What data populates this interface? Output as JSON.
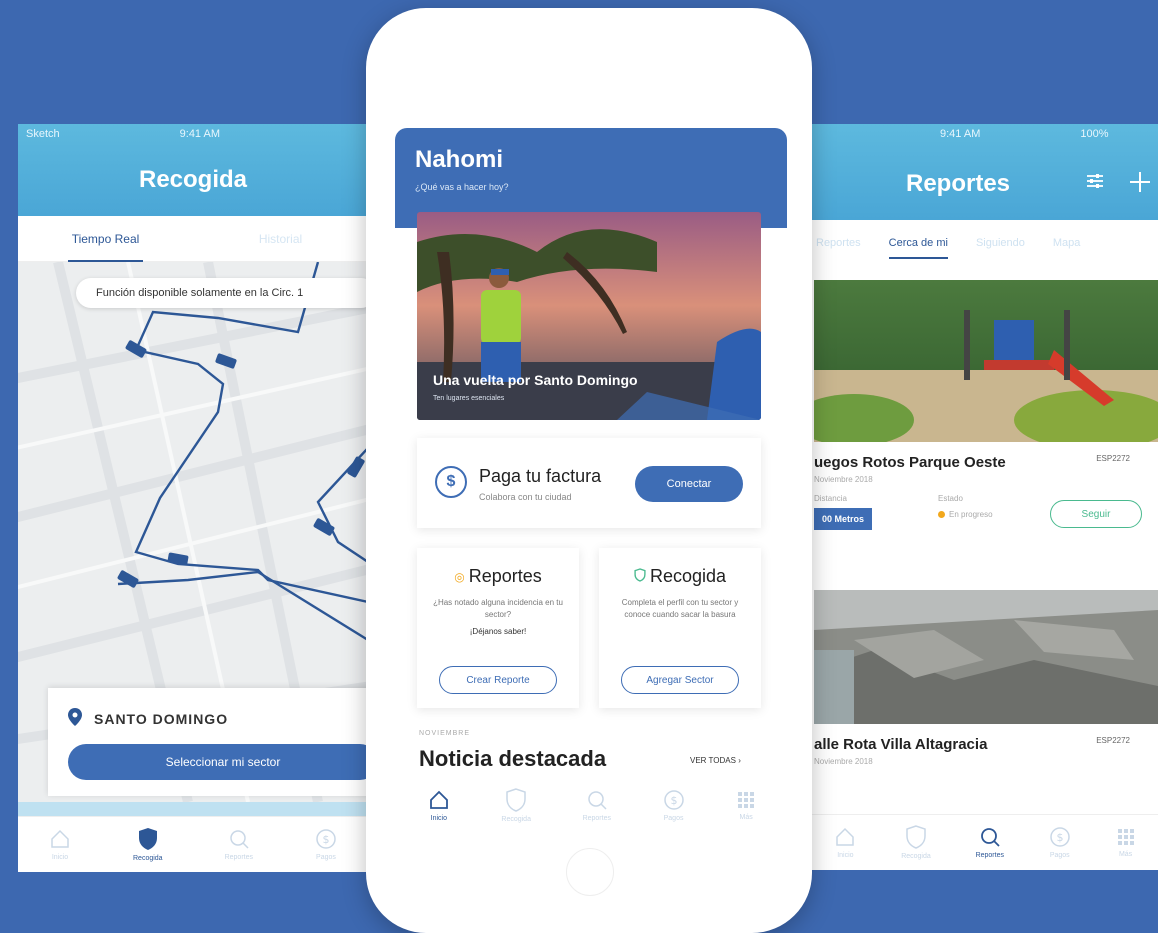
{
  "left_phone": {
    "status": {
      "carrier": "Sketch",
      "time": "9:41 AM"
    },
    "title": "Recogida",
    "tabs": [
      {
        "label": "Tiempo Real"
      },
      {
        "label": "Historial"
      }
    ],
    "map_notice": "Función disponible solamente en la Circ. 1",
    "sector": {
      "name": "SANTO DOMINGO",
      "button": "Seleccionar mi sector"
    },
    "nav": [
      {
        "label": "Inicio",
        "icon": "home-icon"
      },
      {
        "label": "Recogida",
        "icon": "shield-icon"
      },
      {
        "label": "Reportes",
        "icon": "search-icon"
      },
      {
        "label": "Pagos",
        "icon": "dollar-icon"
      }
    ]
  },
  "center_phone": {
    "greeting_name": "Nahomi",
    "greeting_sub": "¿Qué vas a hacer hoy?",
    "hero": {
      "title": "Una vuelta por Santo Domingo",
      "subtitle": "Ten lugares esenciales"
    },
    "pay": {
      "title": "Paga tu factura",
      "subtitle": "Colabora con tu ciudad",
      "button": "Conectar"
    },
    "reportes_card": {
      "title": "Reportes",
      "desc": "¿Has notado alguna incidencia en tu sector?",
      "strong": "¡Déjanos saber!",
      "button": "Crear Reporte"
    },
    "recogida_card": {
      "title": "Recogida",
      "desc": "Completa el perfil con tu sector y conoce cuando sacar la basura",
      "button": "Agregar Sector"
    },
    "news": {
      "kicker": "NOVIEMBRE",
      "title": "Noticia destacada",
      "link": "VER TODAS"
    },
    "nav": [
      {
        "label": "Inicio",
        "icon": "home-icon"
      },
      {
        "label": "Recogida",
        "icon": "shield-icon"
      },
      {
        "label": "Reportes",
        "icon": "search-icon"
      },
      {
        "label": "Pagos",
        "icon": "dollar-icon"
      },
      {
        "label": "Más",
        "icon": "grid-icon"
      }
    ]
  },
  "right_phone": {
    "status": {
      "time": "9:41 AM",
      "battery": "100%"
    },
    "title": "Reportes",
    "tabs": [
      {
        "label": "Reportes"
      },
      {
        "label": "Cerca de mi"
      },
      {
        "label": "Siguiendo"
      },
      {
        "label": "Mapa"
      }
    ],
    "reports": [
      {
        "title": "uegos Rotos Parque Oeste",
        "code": "ESP2272",
        "date": "Noviembre 2018",
        "distance_label": "Distancia",
        "distance": "00 Metros",
        "estado_label": "Estado",
        "estado": "En progreso",
        "button": "Seguir"
      },
      {
        "title": "alle Rota Villa Altagracia",
        "code": "ESP2272",
        "date": "Noviembre 2018"
      }
    ],
    "nav": [
      {
        "label": "Inicio",
        "icon": "home-icon"
      },
      {
        "label": "Recogida",
        "icon": "shield-icon"
      },
      {
        "label": "Reportes",
        "icon": "search-icon"
      },
      {
        "label": "Pagos",
        "icon": "dollar-icon"
      },
      {
        "label": "Más",
        "icon": "grid-icon"
      }
    ]
  },
  "colors": {
    "background": "#3d68b0",
    "primary": "#3e6db5",
    "header_light": "#5db9de",
    "accent_green": "#4aba8f",
    "status_orange": "#f2a81d"
  }
}
